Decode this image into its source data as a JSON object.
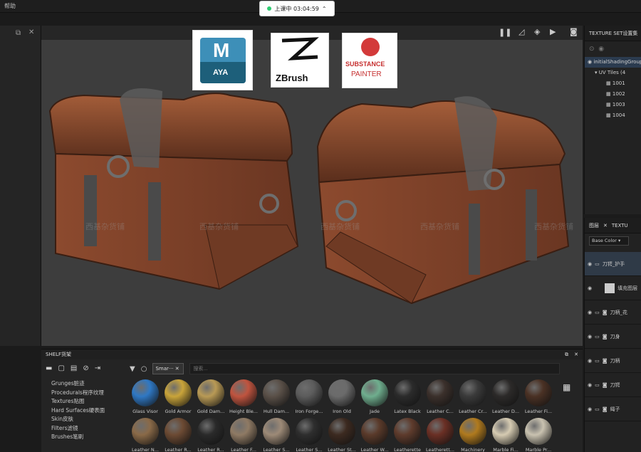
{
  "menubar": {
    "help_label": "帮助"
  },
  "recording": {
    "label": "上课中 03:04:59"
  },
  "viewport": {
    "logos": {
      "maya_top": "M",
      "maya_bottom": "AYA",
      "zbrush": "ZBrush",
      "substance_line1": "SUBSTANCE",
      "substance_line2": "PAINTER"
    },
    "watermark": "西基杂货铺"
  },
  "texture_set_panel": {
    "title": "TEXTURE SET设置集",
    "tree": {
      "shader": "initialShadingGroup",
      "uv_tiles": "UV Tiles (4",
      "tiles": [
        "1001",
        "1002",
        "1003",
        "1004"
      ]
    }
  },
  "layers_panel": {
    "tabs": [
      "图层",
      "TEXTU"
    ],
    "channel": "Base Color",
    "layers": [
      {
        "name": "刀锷_护手",
        "type": "folder"
      },
      {
        "name": "填充图层",
        "type": "fill"
      },
      {
        "name": "刀柄_花",
        "type": "folder"
      },
      {
        "name": "刀身",
        "type": "folder"
      },
      {
        "name": "刀柄",
        "type": "folder"
      },
      {
        "name": "刀锷",
        "type": "folder"
      },
      {
        "name": "绳子",
        "type": "folder"
      }
    ]
  },
  "shelf": {
    "title": "SHELF货架",
    "smart_tab": "Smar···",
    "search_placeholder": "搜索...",
    "categories": [
      "Grunges脏迹",
      "Procedurals程序纹理",
      "Textures贴图",
      "Hard Surfaces硬表面",
      "Skin皮肤",
      "Filters滤镜",
      "Brushes笔刷"
    ],
    "materials_row1": [
      {
        "label": "Glass Visor",
        "color": "#2f78c4"
      },
      {
        "label": "Gold Armor",
        "color": "#c9a43a"
      },
      {
        "label": "Gold Dam...",
        "color": "#b99a55"
      },
      {
        "label": "Height Ble...",
        "color": "#c0543f"
      },
      {
        "label": "Hull Dam...",
        "color": "#5a5048"
      },
      {
        "label": "Iron Forge...",
        "color": "#5c5c5c"
      },
      {
        "label": "Iron Old",
        "color": "#6b6b6b"
      },
      {
        "label": "Jade",
        "color": "#6fae8e"
      },
      {
        "label": "Latex Black",
        "color": "#2b2b2b"
      },
      {
        "label": "Leather C...",
        "color": "#3b302b"
      },
      {
        "label": "Leather Cr...",
        "color": "#3a3a3a"
      },
      {
        "label": "Leather D...",
        "color": "#2c2a29"
      },
      {
        "label": "Leather Fi...",
        "color": "#4a3124"
      }
    ],
    "materials_row2": [
      {
        "label": "Leather N...",
        "color": "#8a6a48"
      },
      {
        "label": "Leather R...",
        "color": "#6c4a33"
      },
      {
        "label": "Leather R...",
        "color": "#2a2a2a"
      },
      {
        "label": "Leather F...",
        "color": "#8f7a64"
      },
      {
        "label": "Leather S...",
        "color": "#9d8a77"
      },
      {
        "label": "Leather S...",
        "color": "#2e2e2e"
      },
      {
        "label": "Leather St...",
        "color": "#3c2a20"
      },
      {
        "label": "Leather W...",
        "color": "#5a3a2a"
      },
      {
        "label": "Leatherette",
        "color": "#5e3b2c"
      },
      {
        "label": "Leatherett...",
        "color": "#6a2f24"
      },
      {
        "label": "Machinery",
        "color": "#b07a1e"
      },
      {
        "label": "Marble Fi...",
        "color": "#d6cbb2"
      },
      {
        "label": "Marble Pr...",
        "color": "#c9c2b0"
      }
    ]
  }
}
